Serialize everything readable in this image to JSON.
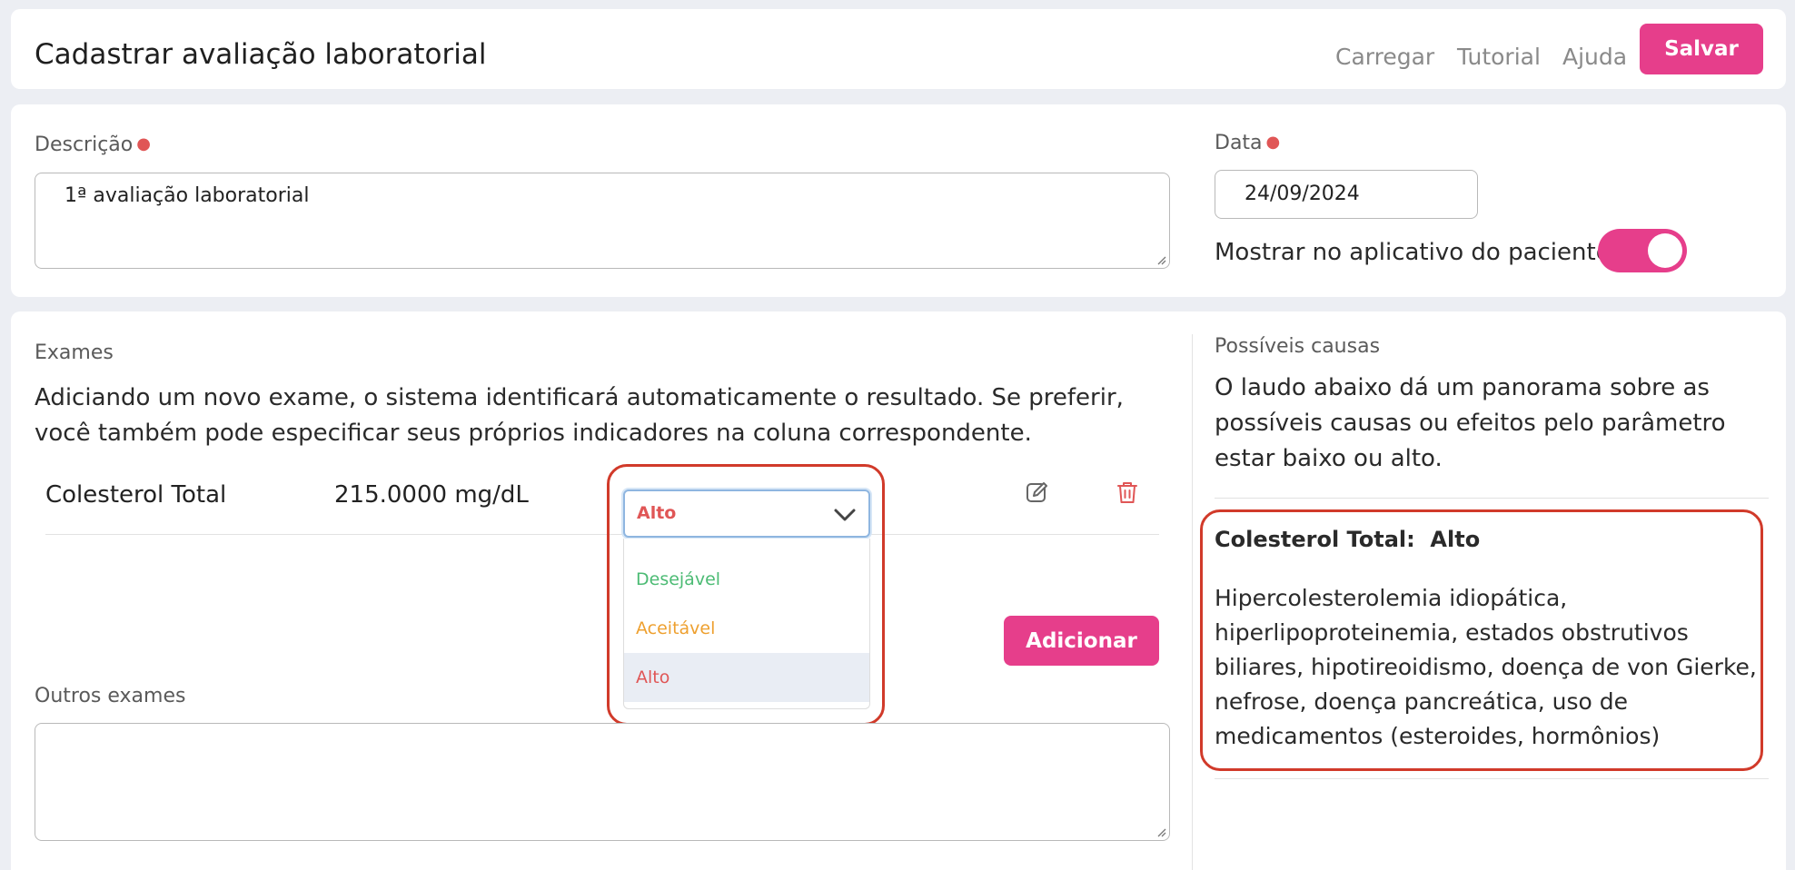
{
  "header": {
    "title": "Cadastrar avaliação laboratorial",
    "nav": {
      "load": "Carregar",
      "tutorial": "Tutorial",
      "help": "Ajuda"
    },
    "save_label": "Salvar"
  },
  "form": {
    "description_label": "Descrição",
    "description_value": "1ª avaliação laboratorial",
    "date_label": "Data",
    "date_value": "24/09/2024",
    "show_in_app_label": "Mostrar no aplicativo do paciente",
    "show_in_app": true
  },
  "exams": {
    "section_label": "Exames",
    "help_text": "Adiciando um novo exame, o sistema identificará automaticamente o resultado. Se preferir, você também pode especificar seus próprios indicadores na coluna correspondente.",
    "rows": [
      {
        "name": "Colesterol Total",
        "value": "215.0000 mg/dL",
        "status": "Alto"
      }
    ],
    "status_options": [
      {
        "label": "Desejável",
        "color": "#4cbb74"
      },
      {
        "label": "Aceitável",
        "color": "#eea02f"
      },
      {
        "label": "Alto",
        "color": "#e05656",
        "selected": true
      }
    ],
    "add_label": "Adicionar",
    "other_label": "Outros exames",
    "other_value": ""
  },
  "causes": {
    "section_label": "Possíveis causas",
    "intro": "O laudo abaixo dá um panorama sobre as possíveis causas ou efeitos pelo parâmetro estar baixo ou alto.",
    "item_title": "Colesterol Total:  Alto",
    "item_text": "Hipercolesterolemia idiopática, hiperlipoproteinemia, estados obstrutivos biliares, hipotireoidismo, doença de von Gierke, nefrose, doença pancreática, uso de medicamentos (esteroides, hormônios)"
  },
  "colors": {
    "accent": "#e63e8b",
    "highlight_box": "#d13a2a",
    "status_high": "#e05656"
  }
}
